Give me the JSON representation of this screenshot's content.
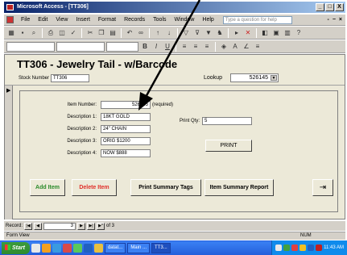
{
  "window": {
    "title": "Microsoft Access - [TT306]",
    "controls": [
      "_",
      "□",
      "X"
    ]
  },
  "menubar": {
    "items": [
      "File",
      "Edit",
      "View",
      "Insert",
      "Format",
      "Records",
      "Tools",
      "Window",
      "Help"
    ],
    "help_placeholder": "Type a question for help",
    "right_controls": [
      "-",
      "−",
      "×"
    ]
  },
  "form": {
    "title": "TT306 - Jewelry Tail - w/Barcode",
    "stock_label": "Stock Number",
    "stock_value": "TT306",
    "lookup_label": "Lookup",
    "lookup_value": "526145",
    "item_number_label": "Item Number:",
    "item_number_value": "526145",
    "required_text": "(required)",
    "desc1_label": "Description 1:",
    "desc1_value": "18KT GOLD",
    "desc2_label": "Description 2:",
    "desc2_value": "24\" CHAIN",
    "desc3_label": "Description 3:",
    "desc3_value": "ORIG $1200",
    "desc4_label": "Description 4:",
    "desc4_value": "NOW $888",
    "print_qty_label": "Print Qty:",
    "print_qty_value": "5",
    "print_button": "PRINT",
    "add_item": "Add Item",
    "delete_item": "Delete Item",
    "print_summary_tags": "Print Summary Tags",
    "item_summary_report": "Item Summary Report"
  },
  "navbar": {
    "record_label": "Record:",
    "current": "3",
    "of_text": "of 3"
  },
  "status": {
    "left": "Form View",
    "right": "NUM"
  },
  "taskbar": {
    "start": "Start",
    "tasks": [
      "datat...",
      "Main ...",
      "TT3..."
    ],
    "clock": "11:43 AM"
  },
  "colors": {
    "add_item": "#2a8a2a",
    "delete_item": "#e0302a",
    "title_bar": "#0a246a"
  }
}
